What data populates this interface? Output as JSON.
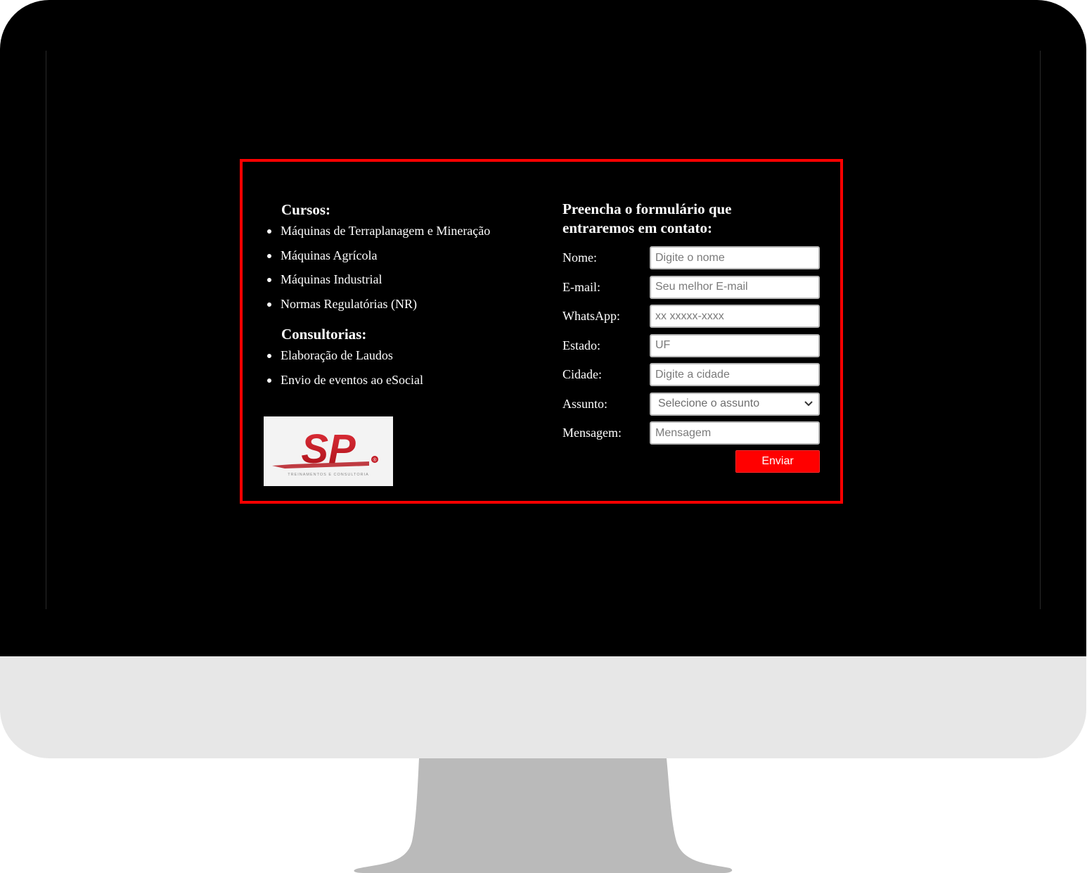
{
  "courses": {
    "title": "Cursos:",
    "items": [
      "Máquinas de Terraplanagem e Mineração",
      "Máquinas Agrícola",
      "Máquinas Industrial",
      "Normas Regulatórias (NR)"
    ]
  },
  "consulting": {
    "title": "Consultorias:",
    "items": [
      "Elaboração de Laudos",
      "Envio de eventos ao eSocial"
    ]
  },
  "logo": {
    "text": "SP",
    "tagline": "TREINAMENTOS E CONSULTORIA",
    "registered": "®"
  },
  "form": {
    "title": "Preencha o formulário que entraremos em contato:",
    "fields": {
      "nome": {
        "label": "Nome:",
        "placeholder": "Digite o nome"
      },
      "email": {
        "label": "E-mail:",
        "placeholder": "Seu melhor E-mail"
      },
      "whatsapp": {
        "label": "WhatsApp:",
        "placeholder": "xx xxxxx-xxxx"
      },
      "estado": {
        "label": "Estado:",
        "placeholder": "UF"
      },
      "cidade": {
        "label": "Cidade:",
        "placeholder": "Digite a cidade"
      },
      "assunto": {
        "label": "Assunto:",
        "selected": "Selecione o assunto"
      },
      "mensagem": {
        "label": "Mensagem:",
        "placeholder": "Mensagem"
      }
    },
    "submit_label": "Enviar"
  },
  "colors": {
    "accent": "#ff0000",
    "screen_bg": "#000000",
    "bezel": "#e7e7e7",
    "stand": "#bababa"
  }
}
